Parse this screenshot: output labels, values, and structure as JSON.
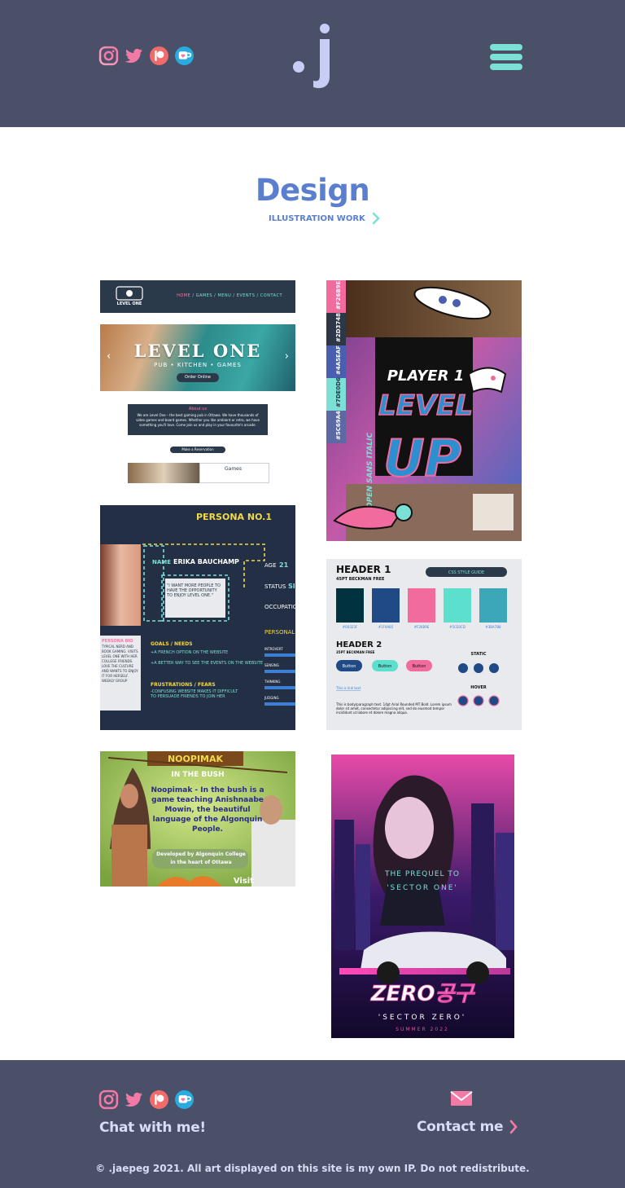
{
  "header": {
    "logo_text": ".j",
    "social": [
      "instagram-icon",
      "twitter-icon",
      "patreon-icon",
      "ko-fi-icon"
    ],
    "menu_icon": "hamburger-menu-icon"
  },
  "main": {
    "title": "Design",
    "subtitle": "ILLUSTRATION WORK",
    "accent_color": "#5b7fcf",
    "tiles": [
      {
        "name": "level-one-website",
        "nav_links": [
          "HOME",
          "GAMES",
          "MENU",
          "EVENTS",
          "CONTACT"
        ],
        "hero_title": "LEVEL ONE",
        "hero_subtitle": "PUB • KITCHEN • GAMES",
        "hero_button": "Order Online",
        "about_title": "About us",
        "about_text": "We are Level One – the best gaming pub in Ottawa. We have thousands of video games and board games. Whether you like ambient or retro, we have something you'll love. Come join us and play in your favourite's arcade.",
        "reserve_button": "Make a Reservation",
        "games_label": "Games"
      },
      {
        "name": "level-up-poster",
        "swatches": [
          "#F26B9E",
          "#2D3748",
          "#4A5EAF",
          "#7DE0D6",
          "#5C69A4"
        ],
        "swatch_labels": [
          "#F26B9E",
          "#2D3748",
          "#4A5EAF",
          "#7DE0D6",
          "#5C69A4"
        ],
        "player_text": "PLAYER 1",
        "level_text": "LEVEL",
        "up_text": "UP",
        "font_text": "OPEN SANS ITALIC"
      },
      {
        "name": "persona-card",
        "header": "PERSONA NO.1",
        "name_label": "NAME",
        "person_name": "ERIKA BAUCHAMP",
        "age_label": "AGE",
        "age": "21",
        "status_label": "STATUS",
        "status_value": "SI",
        "occupation_label": "OCCUPATION",
        "personality_label": "PERSONALI",
        "quote": "\"I WANT MORE PEOPLE TO HAVE THE OPPORTUNITY TO ENJOY LEVEL ONE.\"",
        "goals_title": "GOALS / NEEDS",
        "goals": [
          "+A FRENCH OPTION ON THE WEBSITE",
          "+A BETTER WAY TO SEE THE EVENTS ON THE WEBSITE"
        ],
        "frustrations_title": "FRUSTRATIONS / FEARS",
        "frustrations": [
          "-CONFUSING WEBSITE MAKES IT DIFFICULT TO PERSUADE FRIENDS TO JOIN HER"
        ],
        "bio_title": "PERSONA BIO",
        "bio": "TYPICAL NERD AND BOOK GAMING. VISITS LEVEL ONE WITH HER COLLEGE FRIENDS. LOVE THE CULTURE AND WANTS TO ENJOY IT FOR HERSELF. WEEKLY GROUP",
        "traits": [
          "INTROVERT",
          "SENSING",
          "THINKING",
          "JUDGING"
        ]
      },
      {
        "name": "css-style-guide",
        "header1": "HEADER 1",
        "header1_sub": "45PT BECKMAN FREE",
        "guide_label": "CSS STYLE GUIDE",
        "swatch_colors": [
          "#00323F",
          "#1F4A85",
          "#F26B9E",
          "#5CE0CD",
          "#3BA7B8"
        ],
        "swatch_labels": [
          "#00323F",
          "#1F4A85",
          "#F26B9E",
          "#5CE0CD",
          "#3BA7B8"
        ],
        "header2": "HEADER 2",
        "header2_sub": "35PT BECKMAN FREE",
        "button_label": "Button",
        "static_label": "STATIC",
        "hover_label": "HOVER",
        "link_text": "This is link text",
        "body_text": "This is body/paragraph text. 14pt Arial Rounded MT Bold. Lorem ipsum dolor sit amet, consectetur adipiscing elit, sed do eiusmod tempor incididunt ut labore et dolore magna aliqua."
      },
      {
        "name": "noopimak-game",
        "banner": "NOOPIMAK",
        "banner_sub": "IN THE BUSH",
        "text": "Noopimak - In the bush is a game teaching Anishnaabe Mowin, the beautiful language of the Algonquin People.",
        "dev": "Developed by Algonquin College in the heart of Ottawa",
        "visit": "Visit"
      },
      {
        "name": "zero-poster",
        "prequel": "THE PREQUEL TO",
        "prequel_title": "'SECTOR ONE'",
        "title": "ZERO공구",
        "subtitle": "'SECTOR ZERO'",
        "date": "SUMMER 2022"
      }
    ]
  },
  "footer": {
    "chat_label": "Chat with me!",
    "contact_label": "Contact me",
    "copyright": "© .jaepeg 2021. All art displayed on this site is my own IP. Do not redistribute."
  },
  "colors": {
    "header_bg": "#4a5068",
    "menu": "#7de0d6",
    "pink": "#f47aa6"
  }
}
